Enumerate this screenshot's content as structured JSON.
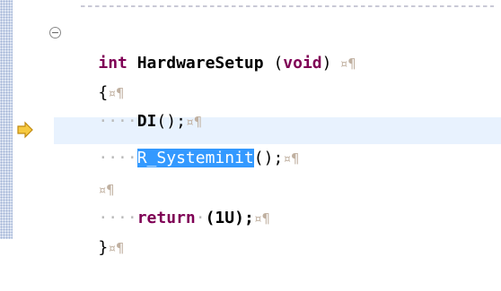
{
  "editor": {
    "lines": [
      {
        "type": "kw",
        "text": "int"
      },
      {
        "fn": "HardwareSetup"
      },
      {
        "paren_open": "("
      },
      {
        "kw2": "void"
      },
      {
        "paren_close": ")"
      },
      {
        "marker": "¤¶"
      }
    ],
    "line1": {
      "kw": "int",
      "fn": "HardwareSetup",
      "args_open": " (",
      "arg": "void",
      "args_close": ")",
      "marks": " ¤¶"
    },
    "line2": {
      "text": "{",
      "marks": "¤¶"
    },
    "line3": {
      "indent": "····",
      "call": "DI",
      "rest": "();",
      "marks": "¤¶"
    },
    "line4": {
      "indent": "····",
      "call_selected": "R_Systeminit",
      "rest": "();",
      "marks": "¤¶"
    },
    "line5": {
      "marks": "¤¶"
    },
    "line6": {
      "indent": "····",
      "kw": "return",
      "sep": "·",
      "expr": "(1U);",
      "marks": "¤¶"
    },
    "line7": {
      "text": "}",
      "marks": "¤¶"
    }
  },
  "icons": {
    "fold": "collapse-fold-icon",
    "current_instruction": "current-instruction-arrow-icon"
  },
  "colors": {
    "keyword": "#7f0055",
    "selection": "#3399ff",
    "current_line": "#e8f2fe",
    "gutter": "#dfe6f3"
  }
}
